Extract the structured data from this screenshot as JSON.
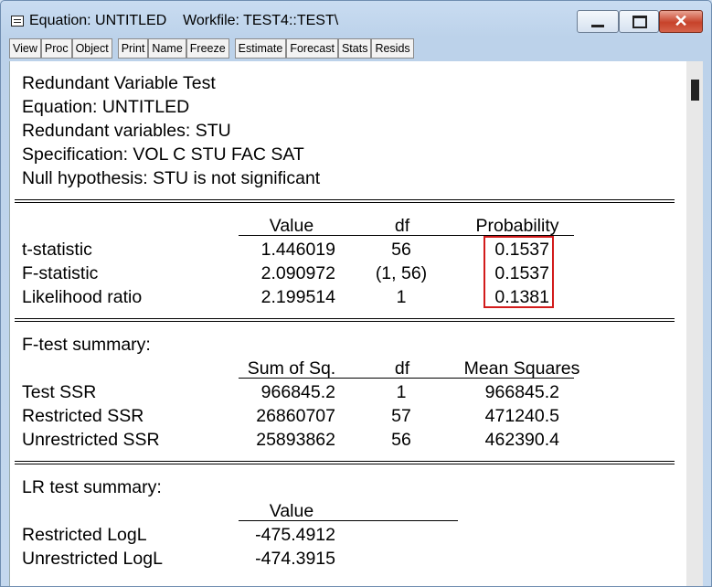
{
  "window": {
    "title": "Equation: UNTITLED    Workfile: TEST4::TEST\\",
    "close_glyph": "✕"
  },
  "toolbar": [
    "View",
    "Proc",
    "Object",
    "Print",
    "Name",
    "Freeze",
    "Estimate",
    "Forecast",
    "Stats",
    "Resids"
  ],
  "header": {
    "test_name": "Redundant Variable Test",
    "equation": "Equation: UNTITLED",
    "redundant": "Redundant variables: STU",
    "specification": "Specification: VOL C STU FAC SAT",
    "null_hypothesis": "Null hypothesis: STU is not significant"
  },
  "tests": {
    "headers": [
      "Value",
      "df",
      "Probability"
    ],
    "rows": [
      {
        "name": "t-statistic",
        "value": "1.446019",
        "df": "56",
        "prob": "0.1537"
      },
      {
        "name": "F-statistic",
        "value": "2.090972",
        "df": "(1, 56)",
        "prob": "0.1537"
      },
      {
        "name": "Likelihood ratio",
        "value": "2.199514",
        "df": "1",
        "prob": "0.1381"
      }
    ]
  },
  "ftest": {
    "title": "F-test summary:",
    "headers": [
      "Sum of Sq.",
      "df",
      "Mean Squares"
    ],
    "rows": [
      {
        "name": "Test SSR",
        "sumsq": "966845.2",
        "df": "1",
        "ms": "966845.2"
      },
      {
        "name": "Restricted SSR",
        "sumsq": "26860707",
        "df": "57",
        "ms": "471240.5"
      },
      {
        "name": "Unrestricted SSR",
        "sumsq": "25893862",
        "df": "56",
        "ms": "462390.4"
      }
    ]
  },
  "lrtest": {
    "title": "LR test summary:",
    "header": "Value",
    "rows": [
      {
        "name": "Restricted LogL",
        "value": "-475.4912"
      },
      {
        "name": "Unrestricted LogL",
        "value": "-474.3915"
      }
    ]
  }
}
